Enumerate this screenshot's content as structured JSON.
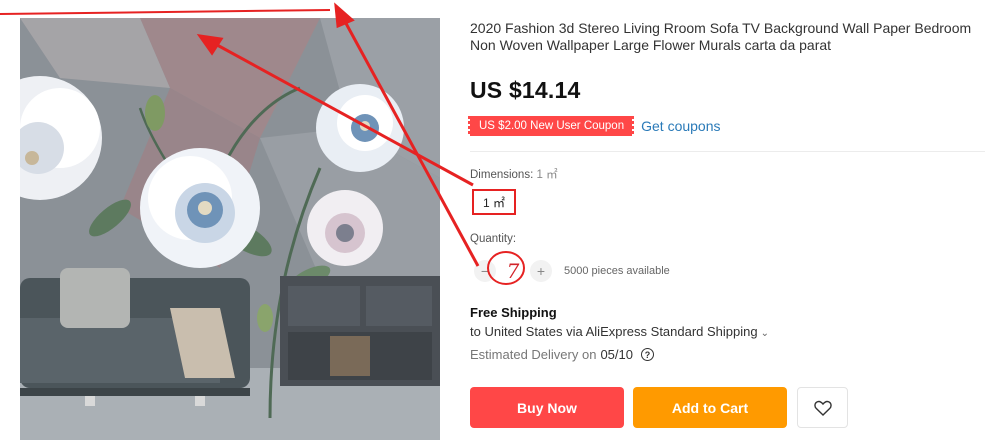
{
  "product": {
    "title": "2020 Fashion 3d Stereo Living Rroom Sofa TV Background Wall Paper Bedroom Non Woven Wallpaper Large Flower Murals carta da parat",
    "price": "US $14.14",
    "coupon_badge": "US $2.00 New User Coupon",
    "get_coupons": "Get coupons"
  },
  "dimensions": {
    "label": "Dimensions:",
    "selected_value": "1 ㎡",
    "options": [
      "1 ㎡"
    ]
  },
  "quantity": {
    "label": "Quantity:",
    "value": "7",
    "decrement": "−",
    "increment": "+",
    "available": "5000 pieces available"
  },
  "shipping": {
    "title": "Free Shipping",
    "route": "to United States via AliExpress Standard Shipping",
    "route_chevron": "⌄",
    "delivery_label": "Estimated Delivery on",
    "delivery_date": "05/10",
    "help_icon": "?"
  },
  "actions": {
    "buy_now": "Buy Now",
    "add_to_cart": "Add to Cart",
    "wishlist_icon": "heart-icon"
  },
  "colors": {
    "accent_red": "#ff4747",
    "cart_orange": "#ff9a00",
    "link_blue": "#2a7ab8",
    "annotation_red": "#e62222"
  }
}
